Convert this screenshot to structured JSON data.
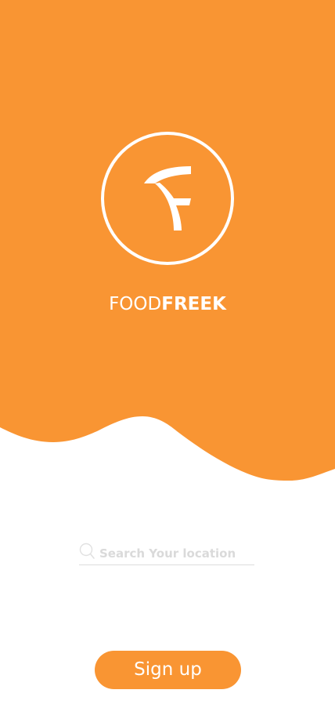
{
  "brand": {
    "name_light": "FOOD",
    "name_bold": "FREEK",
    "logo_icon": "foodfreek-logo-icon"
  },
  "search": {
    "placeholder": "Search Your location",
    "value": "",
    "icon": "search-icon"
  },
  "actions": {
    "signup_label": "Sign up"
  },
  "colors": {
    "brand_orange": "#f99533",
    "background": "#ffffff",
    "placeholder": "#dadada",
    "underline": "#dcdcdc"
  }
}
